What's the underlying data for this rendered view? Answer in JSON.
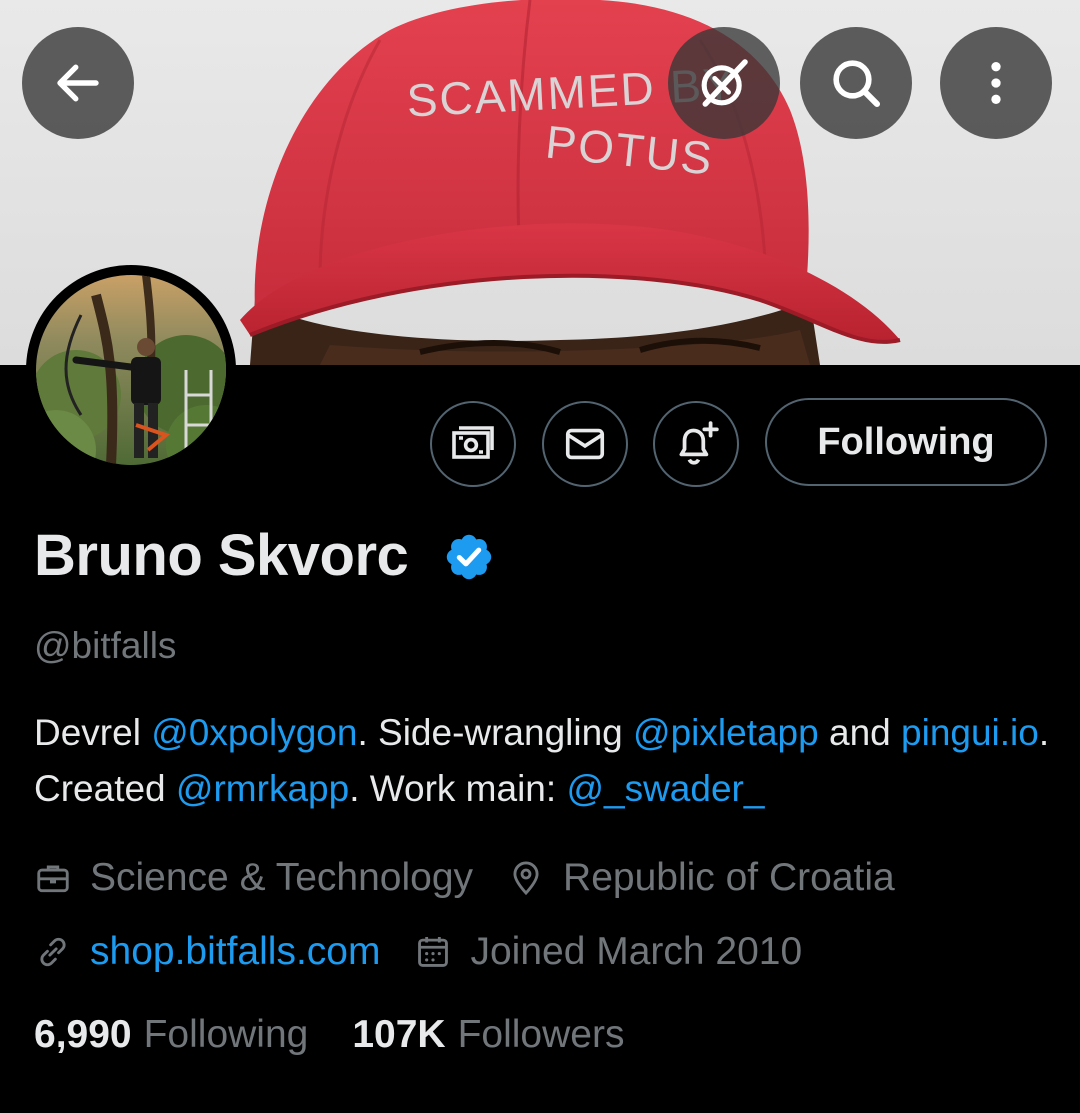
{
  "banner": {
    "hat_text_line1": "SCAMMED BY",
    "hat_text_line2": "POTUS"
  },
  "nav": {
    "back_icon": "arrow-left-icon",
    "grok_icon": "grok-icon",
    "search_icon": "search-icon",
    "more_icon": "more-vertical-icon"
  },
  "profile": {
    "display_name": "Bruno Skvorc",
    "verified": true,
    "handle": "@bitfalls",
    "accent_color": "#1d9bf0"
  },
  "actions": {
    "tip_icon": "money-icon",
    "message_icon": "envelope-icon",
    "notify_icon": "bell-plus-icon",
    "following_label": "Following"
  },
  "bio": {
    "parts": [
      {
        "text": "Devrel ",
        "link": false
      },
      {
        "text": "@0xpolygon",
        "link": true
      },
      {
        "text": ". Side-wrangling ",
        "link": false
      },
      {
        "text": "@pixletapp",
        "link": true
      },
      {
        "text": " and ",
        "link": false
      },
      {
        "text": "pingui.io",
        "link": true
      },
      {
        "text": ". Created ",
        "link": false
      },
      {
        "text": "@rmrkapp",
        "link": true
      },
      {
        "text": ". Work main: ",
        "link": false
      },
      {
        "text": "@_swader_",
        "link": true
      }
    ]
  },
  "meta": {
    "category": "Science & Technology",
    "location": "Republic of Croatia",
    "website": "shop.bitfalls.com",
    "joined": "Joined March 2010"
  },
  "stats": {
    "following_count": "6,990",
    "following_label": "Following",
    "followers_count": "107K",
    "followers_label": "Followers"
  }
}
